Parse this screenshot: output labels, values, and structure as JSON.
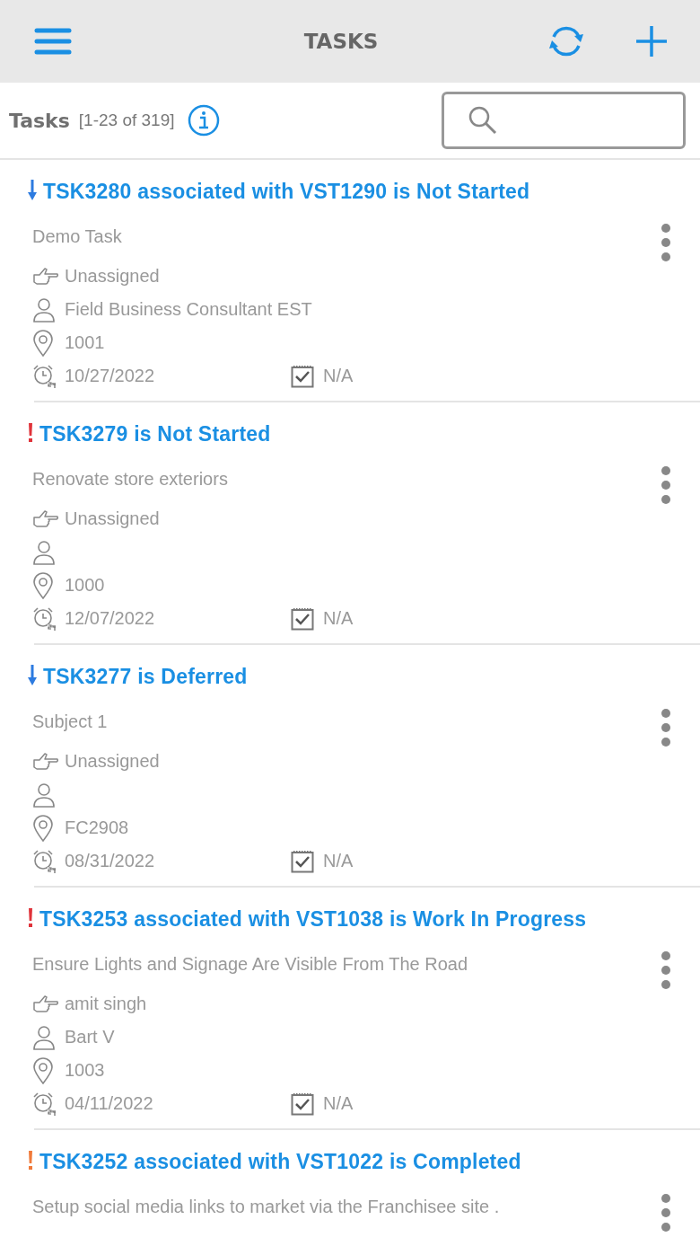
{
  "header": {
    "title": "TASKS"
  },
  "list_header": {
    "title": "Tasks",
    "count": "[1-23 of 319]"
  },
  "tasks": [
    {
      "kind": "low",
      "title": "TSK3280 associated with VST1290 is Not Started",
      "subject": "Demo Task",
      "assignee": "Unassigned",
      "owner": "Field Business Consultant EST",
      "location": "1001",
      "due_date": "10/27/2022",
      "checklist": "N/A"
    },
    {
      "kind": "high",
      "title": "TSK3279 is Not Started",
      "subject": "Renovate store exteriors",
      "assignee": "Unassigned",
      "location": "1000",
      "due_date": "12/07/2022",
      "checklist": "N/A"
    },
    {
      "kind": "low",
      "title": "TSK3277 is Deferred",
      "subject": "Subject 1",
      "assignee": "Unassigned",
      "location": "FC2908",
      "due_date": "08/31/2022",
      "checklist": "N/A"
    },
    {
      "kind": "high",
      "title": "TSK3253 associated with VST1038 is Work In Progress",
      "subject": "Ensure Lights and Signage Are Visible From The Road",
      "assignee": "amit singh",
      "owner": "Bart V",
      "location": "1003",
      "due_date": "04/11/2022",
      "checklist": "N/A"
    },
    {
      "kind": "medium",
      "title": "TSK3252 associated with VST1022 is Completed",
      "subject": "Setup social media links to market via the Franchisee site ."
    }
  ]
}
